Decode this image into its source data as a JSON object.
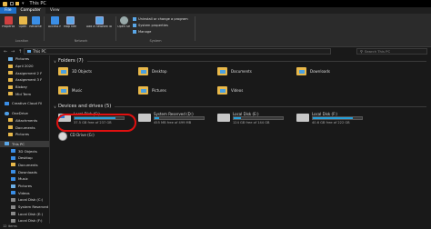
{
  "window": {
    "title": "This PC"
  },
  "ribbon_tabs": [
    {
      "label": "File"
    },
    {
      "label": "Computer"
    },
    {
      "label": "View"
    }
  ],
  "ribbon": {
    "buttons": [
      {
        "label": "Properties"
      },
      {
        "label": "Open"
      },
      {
        "label": "Rename"
      },
      {
        "label": "Access media"
      },
      {
        "label": "Map network drive"
      },
      {
        "label": "Add a network location"
      },
      {
        "label": "Open Settings"
      }
    ],
    "system_links": [
      {
        "label": "Uninstall or change a program"
      },
      {
        "label": "System properties"
      },
      {
        "label": "Manage"
      }
    ],
    "groups": [
      {
        "label": "Location"
      },
      {
        "label": "Network"
      },
      {
        "label": "System"
      }
    ]
  },
  "address": {
    "path": "This PC",
    "search_placeholder": "Search This PC"
  },
  "navpane": {
    "items": [
      {
        "label": "Pictures"
      },
      {
        "label": "April 2020"
      },
      {
        "label": "Assignment 2 F"
      },
      {
        "label": "Assignment 3 F"
      },
      {
        "label": "Bixbey"
      },
      {
        "label": "Mid Term"
      },
      {
        "label": "Creative Cloud Fil"
      },
      {
        "label": "OneDrive"
      },
      {
        "label": "Attachments"
      },
      {
        "label": "Documents"
      },
      {
        "label": "Pictures"
      },
      {
        "label": "This PC"
      },
      {
        "label": "3D Objects"
      },
      {
        "label": "Desktop"
      },
      {
        "label": "Documents"
      },
      {
        "label": "Downloads"
      },
      {
        "label": "Music"
      },
      {
        "label": "Pictures"
      },
      {
        "label": "Videos"
      },
      {
        "label": "Local Disk (C:)"
      },
      {
        "label": "System Reserved"
      },
      {
        "label": "Local Disk (E:)"
      },
      {
        "label": "Local Disk (F:)"
      }
    ]
  },
  "sections": {
    "folders_title": "Folders (7)",
    "devices_title": "Devices and drives (5)"
  },
  "folders": [
    {
      "label": "3D Objects"
    },
    {
      "label": "Desktop"
    },
    {
      "label": "Documents"
    },
    {
      "label": "Downloads"
    },
    {
      "label": "Music"
    },
    {
      "label": "Pictures"
    },
    {
      "label": "Videos"
    }
  ],
  "drives": [
    {
      "label": "Local Disk (C:)",
      "free": "37.5 GB free of 237 GB",
      "used_fraction": 0.84
    },
    {
      "label": "System Reserved (D:)",
      "free": "455 MB free of 499 MB",
      "used_fraction": 0.09
    },
    {
      "label": "Local Disk (E:)",
      "free": "124 GB free of 144 GB",
      "used_fraction": 0.14
    },
    {
      "label": "Local Disk (F:)",
      "free": "40.6 GB free of 222 GB",
      "used_fraction": 0.82
    }
  ],
  "cd_drive": {
    "label": "CD Drive (G:)"
  },
  "status": {
    "items_count": "12 items"
  },
  "colors": {
    "accent": "#1f6fc8",
    "drive_bar": "#26a0da",
    "highlight": "#e01010"
  }
}
